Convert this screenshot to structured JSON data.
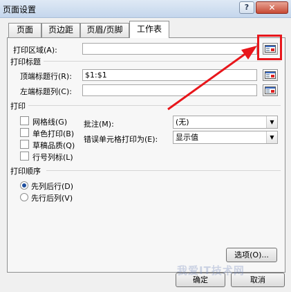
{
  "window": {
    "title": "页面设置",
    "help_label": "?",
    "close_label": "✕"
  },
  "tabs": [
    {
      "label": "页面",
      "active": false
    },
    {
      "label": "页边距",
      "active": false
    },
    {
      "label": "页眉/页脚",
      "active": false
    },
    {
      "label": "工作表",
      "active": true
    }
  ],
  "print_area": {
    "label": "打印区域(A):",
    "value": ""
  },
  "print_titles": {
    "heading": "打印标题",
    "top_rows_label": "顶端标题行(R):",
    "top_rows_value": "$1:$1",
    "left_cols_label": "左端标题列(C):",
    "left_cols_value": ""
  },
  "print": {
    "heading": "打印",
    "gridlines": {
      "label": "网格线(G)",
      "checked": false
    },
    "black_white": {
      "label": "单色打印(B)",
      "checked": false
    },
    "draft": {
      "label": "草稿品质(Q)",
      "checked": false
    },
    "row_col_headings": {
      "label": "行号列标(L)",
      "checked": false
    },
    "comments_label": "批注(M):",
    "comments_value": "(无)",
    "cell_errors_label": "错误单元格打印为(E):",
    "cell_errors_value": "显示值"
  },
  "page_order": {
    "heading": "打印顺序",
    "down_then_over": {
      "label": "先列后行(D)",
      "checked": true
    },
    "over_then_down": {
      "label": "先行后列(V)",
      "checked": false
    }
  },
  "buttons": {
    "options": "选项(O)...",
    "ok": "确定",
    "cancel": "取消"
  },
  "watermark": "我爱IT技术网",
  "colors": {
    "annotation_red": "#e8161b",
    "radio_dot": "#1f4f9e",
    "order_arrow": "#2a8f88"
  },
  "icons": {
    "collapse_dialog": "collapse-dialog-icon",
    "dropdown": "chevron-down-icon"
  }
}
